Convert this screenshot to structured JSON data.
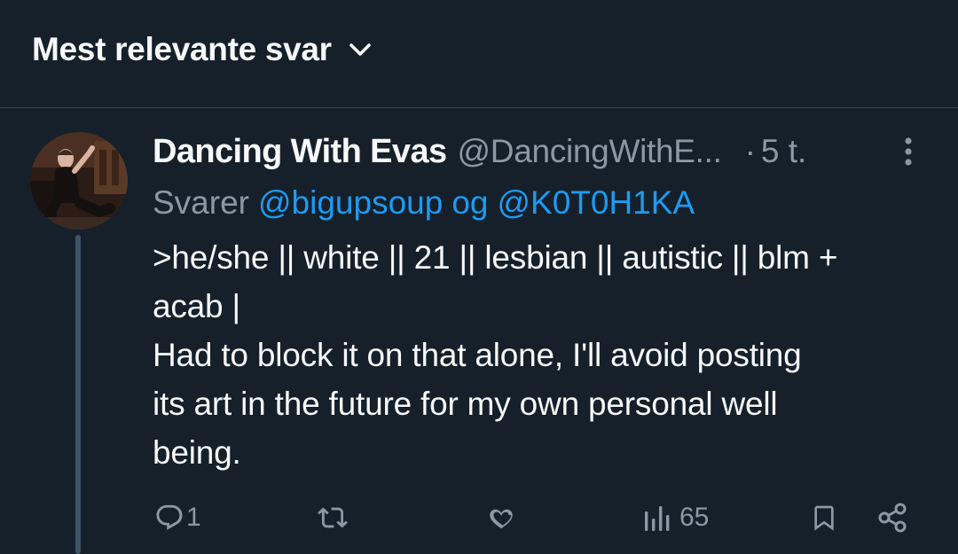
{
  "header": {
    "sort_label": "Mest relevante svar",
    "sort_icon": "chevron-down-icon"
  },
  "tweet": {
    "author_name": "Dancing With Evas",
    "author_handle": "@DancingWithE...",
    "separator": "·",
    "timestamp": "5 t.",
    "reply_prefix": "Svarer",
    "reply_mention_1": "@bigupsoup",
    "reply_joiner": "og",
    "reply_mention_2": "@K0T0H1KA",
    "text_line_1": ">he/she || white || 21 || lesbian || autistic || blm +",
    "text_line_2": "acab |",
    "text_line_3": "Had to block it on that alone, I'll avoid posting",
    "text_line_4": "its art in the future for my own personal well",
    "text_line_5": "being."
  },
  "actions": {
    "reply_count": "1",
    "retweet_count": "",
    "like_count": "",
    "views_count": "65"
  },
  "colors": {
    "background": "#15202b",
    "text_primary": "#f7f9f9",
    "text_secondary": "#8b98a5",
    "accent": "#1d9bf0",
    "divider": "#38444d",
    "thread_line": "#3d5466"
  },
  "icons": [
    "chevron-down-icon",
    "more-icon",
    "reply-icon",
    "retweet-icon",
    "like-icon",
    "views-icon",
    "bookmark-icon",
    "share-icon"
  ]
}
